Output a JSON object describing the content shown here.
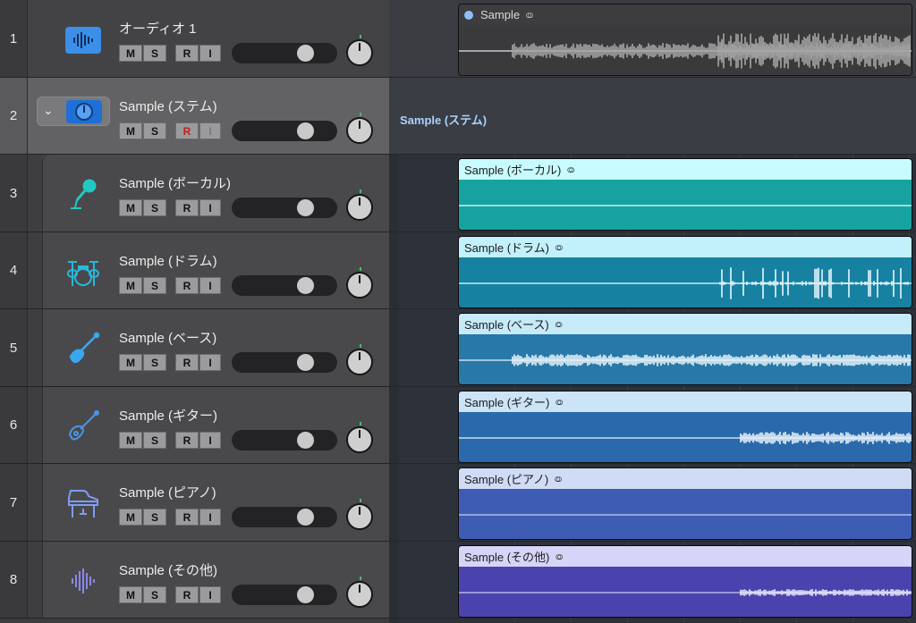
{
  "tracks": [
    {
      "num": "1",
      "name": "オーディオ 1",
      "rec": false
    },
    {
      "num": "2",
      "name": "Sample (ステム)",
      "rec": true
    },
    {
      "num": "3",
      "name": "Sample (ボーカル)",
      "rec": false
    },
    {
      "num": "4",
      "name": "Sample (ドラム)",
      "rec": false
    },
    {
      "num": "5",
      "name": "Sample (ベース)",
      "rec": false
    },
    {
      "num": "6",
      "name": "Sample (ギター)",
      "rec": false
    },
    {
      "num": "7",
      "name": "Sample (ピアノ)",
      "rec": false
    },
    {
      "num": "8",
      "name": "Sample (その他)",
      "rec": false
    }
  ],
  "buttons": {
    "mute": "M",
    "solo": "S",
    "record": "R",
    "input": "I"
  },
  "timeline": {
    "stem_label": "Sample (ステム)",
    "regions": [
      {
        "title": "Sample",
        "header_color": "#3d3d3f",
        "body_color": "#3a3a3c",
        "wave_color": "#a6a6a6",
        "center_color": "#c9c9c9"
      },
      {
        "title": "Sample (ボーカル)",
        "header_color": "#c7fbff",
        "body_color": "#17a2a0",
        "wave_color": "#e7fdfd",
        "center_color": "#bff3f2"
      },
      {
        "title": "Sample (ドラム)",
        "header_color": "#c2f0fb",
        "body_color": "#1781a2",
        "wave_color": "#e8f7fd",
        "center_color": "#c3ecf6"
      },
      {
        "title": "Sample (ベース)",
        "header_color": "#c7eaf9",
        "body_color": "#2878a8",
        "wave_color": "#e9f5fc",
        "center_color": "#c6e2f2"
      },
      {
        "title": "Sample (ギター)",
        "header_color": "#cce4f7",
        "body_color": "#2a6aac",
        "wave_color": "#eaf3fb",
        "center_color": "#c9dcf0"
      },
      {
        "title": "Sample (ピアノ)",
        "header_color": "#d0dcf6",
        "body_color": "#3e5cb3",
        "wave_color": "#e7ecfa",
        "center_color": "#aebfe8"
      },
      {
        "title": "Sample (その他)",
        "header_color": "#d6d4f7",
        "body_color": "#4a43ae",
        "wave_color": "#ebe9fb",
        "center_color": "#b6b2ea"
      }
    ]
  },
  "icons": [
    "waveform-icon",
    "folder-dial-icon",
    "microphone-icon",
    "drum-kit-icon",
    "bass-guitar-icon",
    "guitar-icon",
    "piano-icon",
    "waveform-bars-icon",
    "link-rings-icon"
  ]
}
